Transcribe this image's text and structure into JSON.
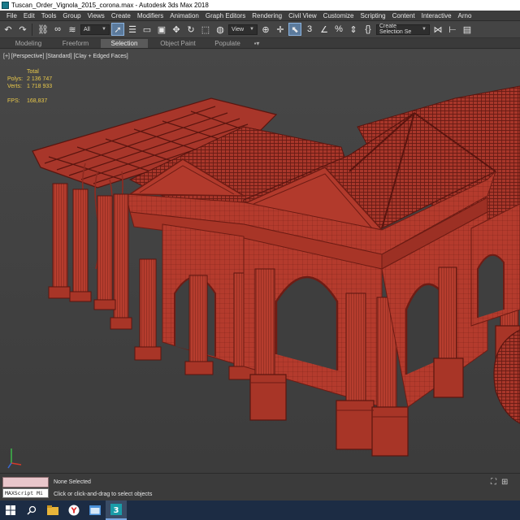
{
  "window": {
    "title": "Tuscan_Order_Vignola_2015_corona.max - Autodesk 3ds Max 2018"
  },
  "menu": [
    "File",
    "Edit",
    "Tools",
    "Group",
    "Views",
    "Create",
    "Modifiers",
    "Animation",
    "Graph Editors",
    "Rendering",
    "Civil View",
    "Customize",
    "Scripting",
    "Content",
    "Interactive",
    "Arno"
  ],
  "toolbar": {
    "selection_filter": "All",
    "reference_coord": "View",
    "named_selection": "Create Selection Se"
  },
  "ribbon_tabs": [
    {
      "label": "Modeling",
      "active": false
    },
    {
      "label": "Freeform",
      "active": false
    },
    {
      "label": "Selection",
      "active": true
    },
    {
      "label": "Object Paint",
      "active": false
    },
    {
      "label": "Populate",
      "active": false
    }
  ],
  "viewport": {
    "label": "[+] [Perspective] [Standard] [Clay + Edged Faces]",
    "stats_header": "Total",
    "polys_label": "Polys:",
    "polys_value": "2 136 747",
    "verts_label": "Verts:",
    "verts_value": "1 718 933",
    "fps_label": "FPS:",
    "fps_value": "168,837"
  },
  "status": {
    "maxscript": "MAXScript Mi",
    "selection": "None Selected",
    "prompt": "Click or click-and-drag to select objects"
  },
  "colors": {
    "model_fill": "#b23a2c",
    "model_edge": "#6e1c14",
    "stats_text": "#e8c84a",
    "active_tab": "#5a5a5a",
    "taskbar": "#1c2c44"
  },
  "taskbar_icons": [
    "windows-start",
    "search",
    "file-explorer",
    "yandex-browser",
    "window-manager",
    "3ds-max"
  ]
}
